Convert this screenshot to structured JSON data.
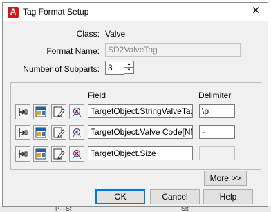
{
  "window": {
    "title": "Tag Format Setup",
    "app_icon_letter": "A",
    "close_glyph": "✕"
  },
  "fields": {
    "class_label": "Class:",
    "class_value": "Valve",
    "format_name_label": "Format Name:",
    "format_name_value": "SD2ValveTag",
    "subparts_label": "Number of Subparts:",
    "subparts_value": "3"
  },
  "table": {
    "field_header": "Field",
    "delimiter_header": "Delimiter",
    "rows": [
      {
        "field": "TargetObject.StringValveTag[a",
        "delimiter": "\\p",
        "delimiter_enabled": true
      },
      {
        "field": "TargetObject.Valve Code[NNN",
        "delimiter": "-",
        "delimiter_enabled": true
      },
      {
        "field": "TargetObject.Size",
        "delimiter": "",
        "delimiter_enabled": false
      }
    ],
    "row_icons": [
      "format-icon",
      "select-property-icon",
      "edit-expression-icon",
      "remove-property-icon"
    ]
  },
  "buttons": {
    "more": "More >>",
    "ok": "OK",
    "cancel": "Cancel",
    "help": "Help"
  },
  "background": {
    "partial_text_left": "P—St",
    "partial_text_right": "Sit"
  },
  "colors": {
    "accent": "#0078d7",
    "app_icon": "#d0171a",
    "dialog_bg": "#f0f0f0"
  }
}
